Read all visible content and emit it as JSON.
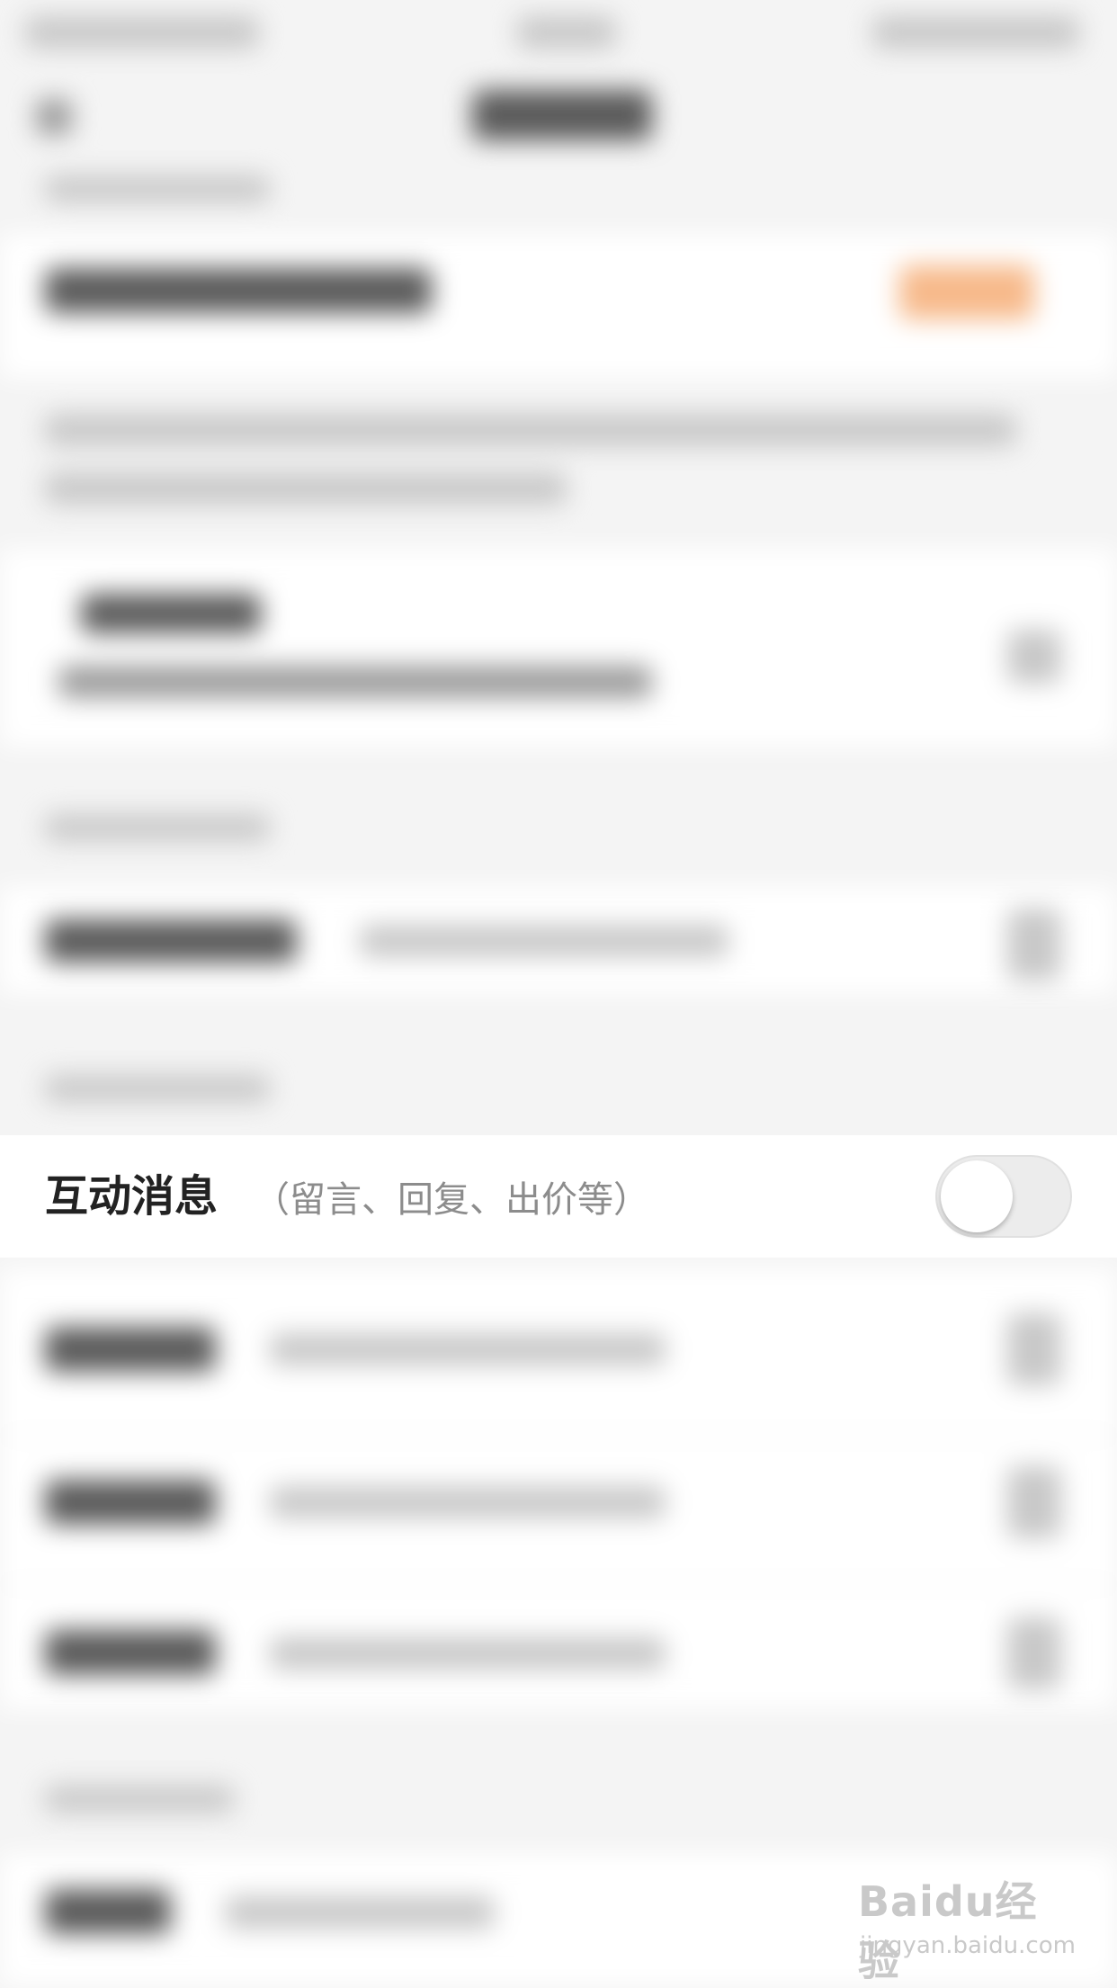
{
  "notification_settings": {
    "interaction_message": {
      "title": "互动消息",
      "description": "（留言、回复、出价等）",
      "toggle_on": false
    }
  },
  "watermark": {
    "logo": "Baidu经验",
    "url": "jingyan.baidu.com"
  }
}
